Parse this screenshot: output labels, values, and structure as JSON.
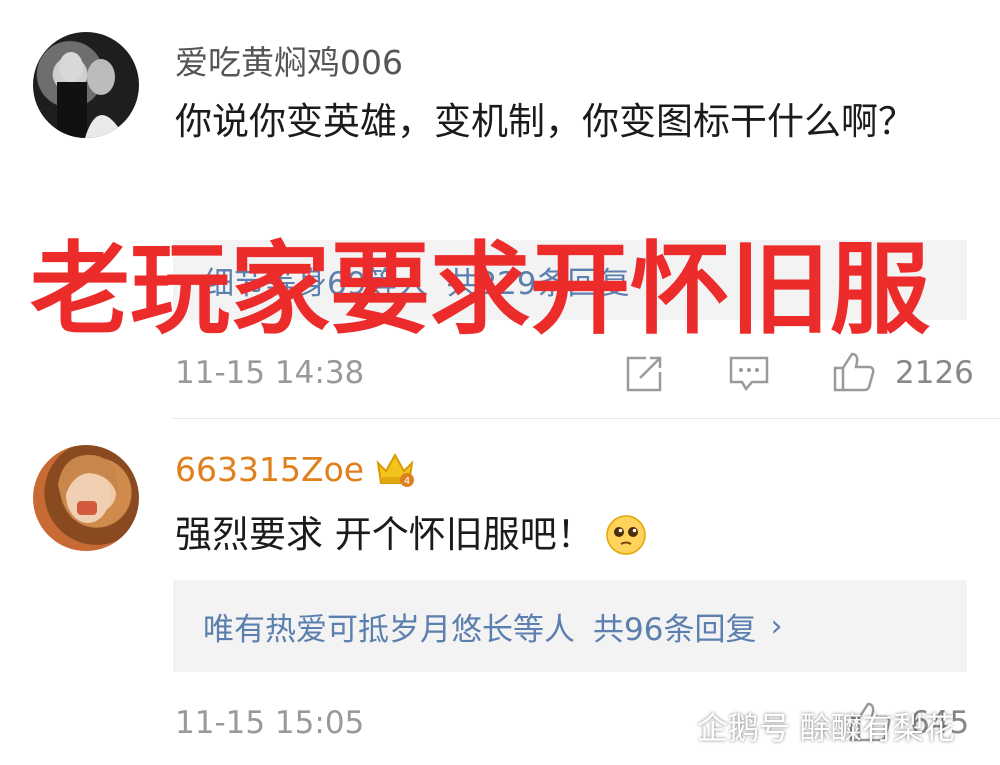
{
  "comments": [
    {
      "username": "爱吃黄焖鸡006",
      "text": "你说你变英雄，变机制，你变图标干什么啊？",
      "reply_summary": {
        "names": "细节等身69等人",
        "total": "共229条回复"
      },
      "timestamp": "11-15 14:38",
      "likes": "2126"
    },
    {
      "username": "663315Zoe",
      "badge_level": "4",
      "text": "强烈要求 开个怀旧服吧！",
      "reply_summary": {
        "names": "唯有热爱可抵岁月悠长等人",
        "total": "共96条回复"
      },
      "timestamp": "11-15 15:05",
      "likes": "645"
    }
  ],
  "overlay_caption": "老玩家要求开怀旧服",
  "watermark": "企鹅号 酴醾有梨花",
  "colors": {
    "overlay": "#ec2b2b",
    "username_vip": "#e0801c",
    "link": "#5b7fae"
  },
  "icons": [
    "share-icon",
    "comment-icon",
    "like-icon",
    "crown-badge-icon",
    "pleading-emoji-icon",
    "watermark-logo-icon"
  ]
}
